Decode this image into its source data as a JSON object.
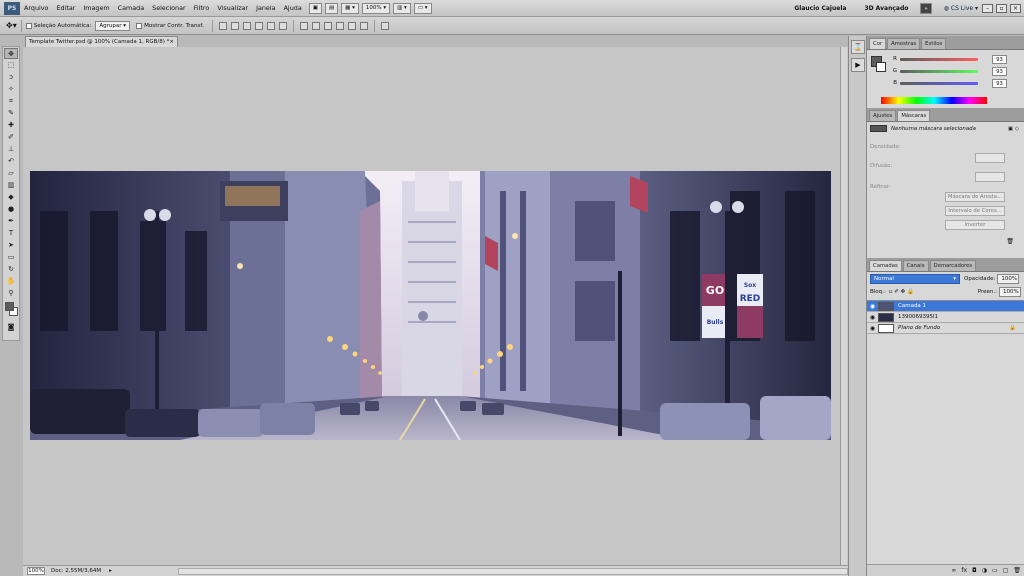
{
  "app": {
    "logo": "PS"
  },
  "menu": {
    "items": [
      "Arquivo",
      "Editar",
      "Imagem",
      "Camada",
      "Selecionar",
      "Filtro",
      "Visualizar",
      "Janela",
      "Ajuda"
    ],
    "zoom": "100%"
  },
  "menubar_right": {
    "workspace_user": "Glaucio Cajuela",
    "workspace_3d": "3D Avançado",
    "cs_live": "CS Live"
  },
  "options": {
    "auto_select_label": "Seleção Automática:",
    "auto_select_value": "Agrupar",
    "show_transform_label": "Mostrar Contr. Transf."
  },
  "document": {
    "tab_title": "Template Twitter.psd @ 100% (Camada 1, RGB/8) *",
    "close": "×"
  },
  "status": {
    "zoom": "100%",
    "doc_size": "Doc: 2,55M/3,64M"
  },
  "color_panel": {
    "tabs": [
      "Cor",
      "Amostras",
      "Estilos"
    ],
    "r": {
      "label": "R",
      "value": "93"
    },
    "g": {
      "label": "G",
      "value": "93"
    },
    "b": {
      "label": "B",
      "value": "93"
    }
  },
  "masks_panel": {
    "tabs": [
      "Ajustes",
      "Máscaras"
    ],
    "status": "Nenhuma máscara selecionada",
    "density_label": "Densidade:",
    "feather_label": "Difusão:",
    "refine_label": "Refinar:",
    "btn_mask_edge": "Máscara de Aresta...",
    "btn_color_range": "Intervalo de Cores...",
    "btn_invert": "Inverter"
  },
  "layers_panel": {
    "tabs": [
      "Camadas",
      "Canais",
      "Demarcadores"
    ],
    "blend_mode": "Normal",
    "opacity_label": "Opacidade:",
    "opacity_value": "100%",
    "lock_label": "Bloq.:",
    "fill_label": "Preen.:",
    "fill_value": "100%",
    "layers": [
      {
        "name": "Camada 1",
        "selected": true
      },
      {
        "name": "1390069395l1",
        "selected": false
      },
      {
        "name": "Plano de Fundo",
        "selected": false
      }
    ]
  },
  "image": {
    "banner_left": "GO",
    "banner_left_sub": "Bulls",
    "banner_right": "RED",
    "banner_right_sub": "Sox"
  },
  "colors": {
    "accent": "#3b78d8",
    "foreground": "#5d5d5d",
    "background": "#ffffff"
  }
}
